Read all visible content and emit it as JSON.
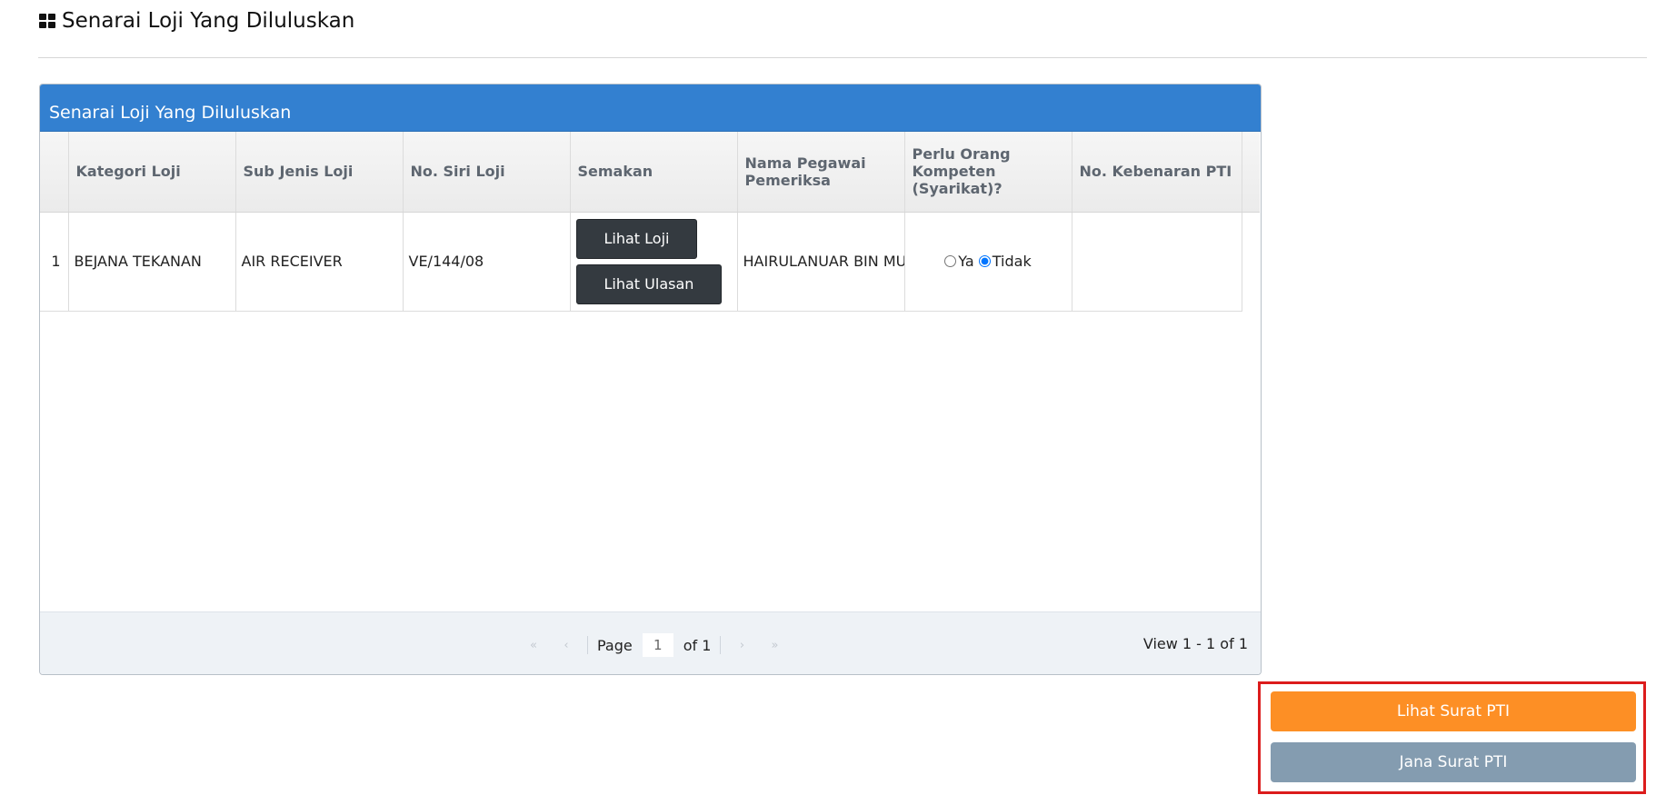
{
  "header": {
    "title": "Senarai Loji Yang Diluluskan",
    "icon": "grid-icon"
  },
  "grid": {
    "caption": "Senarai Loji Yang Diluluskan",
    "columns": [
      "",
      "Kategori Loji",
      "Sub Jenis Loji",
      "No. Siri Loji",
      "Semakan",
      "Nama Pegawai Pemeriksa",
      "Perlu Orang Kompeten (Syarikat)?",
      "No. Kebenaran PTI"
    ],
    "rows": [
      {
        "num": "1",
        "kategori": "BEJANA TEKANAN",
        "sub_jenis": "AIR RECEIVER",
        "no_siri": "VE/144/08",
        "btn_lihat_loji": "Lihat Loji",
        "btn_lihat_ulasan": "Lihat Ulasan",
        "pegawai": "HAIRULANUAR BIN MUR",
        "radio_ya": "Ya",
        "radio_tidak": "Tidak",
        "selected": "Tidak",
        "kebenaran": ""
      }
    ]
  },
  "pager": {
    "page_label": "Page",
    "page_value": "1",
    "of_label": "of 1",
    "view_text": "View 1 - 1 of 1",
    "first_icon": "double-chevron-left-icon",
    "prev_icon": "chevron-left-icon",
    "next_icon": "chevron-right-icon",
    "last_icon": "double-chevron-right-icon"
  },
  "actions": {
    "lihat_surat": "Lihat Surat PTI",
    "jana_surat": "Jana Surat PTI"
  },
  "colors": {
    "caption_bg": "#3380d0",
    "orange": "#fd8f25",
    "gray": "#849cb0",
    "highlight_border": "#dc1c1c",
    "dark_button": "#343a40"
  }
}
